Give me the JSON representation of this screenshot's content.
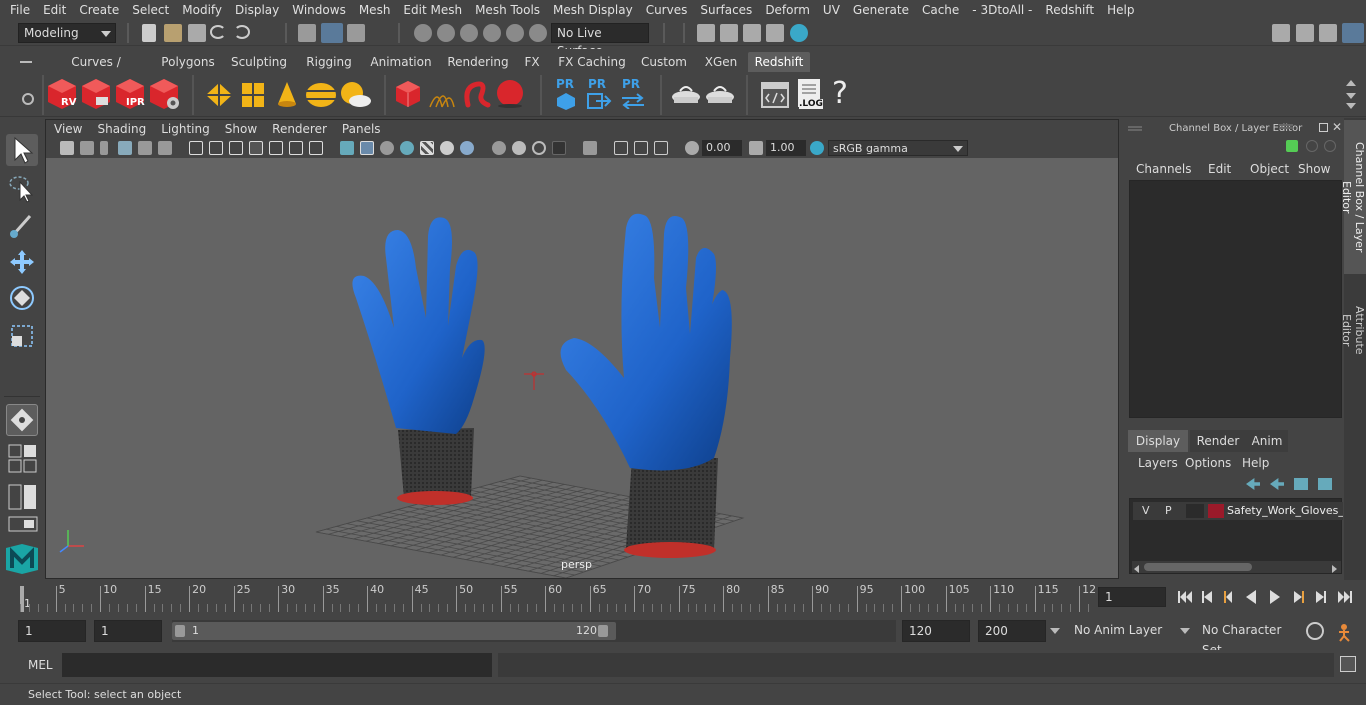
{
  "menubar": [
    "File",
    "Edit",
    "Create",
    "Select",
    "Modify",
    "Display",
    "Windows",
    "Mesh",
    "Edit Mesh",
    "Mesh Tools",
    "Mesh Display",
    "Curves",
    "Surfaces",
    "Deform",
    "UV",
    "Generate",
    "Cache",
    "- 3DtoAll -",
    "Redshift",
    "Help"
  ],
  "status": {
    "mode": "Modeling",
    "live_surface": "No Live Surface"
  },
  "shelf_tabs": [
    "Curves / Surfaces",
    "Polygons",
    "Sculpting",
    "Rigging",
    "Animation",
    "Rendering",
    "FX",
    "FX Caching",
    "Custom",
    "XGen",
    "Redshift"
  ],
  "shelf_active": "Redshift",
  "shelf_labels": {
    "rv": "RV",
    "ipr": "IPR",
    "pr": "PR",
    "log": ".LOG",
    "help": "?"
  },
  "viewport": {
    "menu": [
      "View",
      "Shading",
      "Lighting",
      "Show",
      "Renderer",
      "Panels"
    ],
    "exposure": "0.00",
    "gamma": "1.00",
    "color_space": "sRGB gamma",
    "camera_label": "persp"
  },
  "channel_box": {
    "title": "Channel Box / Layer Editor",
    "menu": [
      "Channels",
      "Edit",
      "Object",
      "Show"
    ],
    "layer_tabs": [
      "Display",
      "Render",
      "Anim"
    ],
    "layer_menu": [
      "Layers",
      "Options",
      "Help"
    ],
    "layer_row": {
      "v": "V",
      "p": "P",
      "name": "Safety_Work_Gloves_G",
      "color": "#9b1a2a"
    }
  },
  "side_tabs": [
    "Channel Box / Layer Editor",
    "Attribute Editor"
  ],
  "timeline": {
    "ticks": [
      "5",
      "10",
      "15",
      "20",
      "25",
      "30",
      "35",
      "40",
      "45",
      "50",
      "55",
      "60",
      "65",
      "70",
      "75",
      "80",
      "85",
      "90",
      "95",
      "100",
      "105",
      "110",
      "115",
      "12"
    ],
    "start_marker": "1",
    "current_frame": "1"
  },
  "range": {
    "start": "1",
    "playback_start": "1",
    "slider_start": "1",
    "slider_end": "120",
    "playback_end": "120",
    "end": "200",
    "anim_layer": "No Anim Layer",
    "character_set": "No Character Set"
  },
  "command": {
    "label": "MEL"
  },
  "help_line": "Select Tool: select an object",
  "colors": {
    "glove_blue": "#1f63c9",
    "cuff_red": "#c0302a",
    "accent": "#5285a6"
  }
}
